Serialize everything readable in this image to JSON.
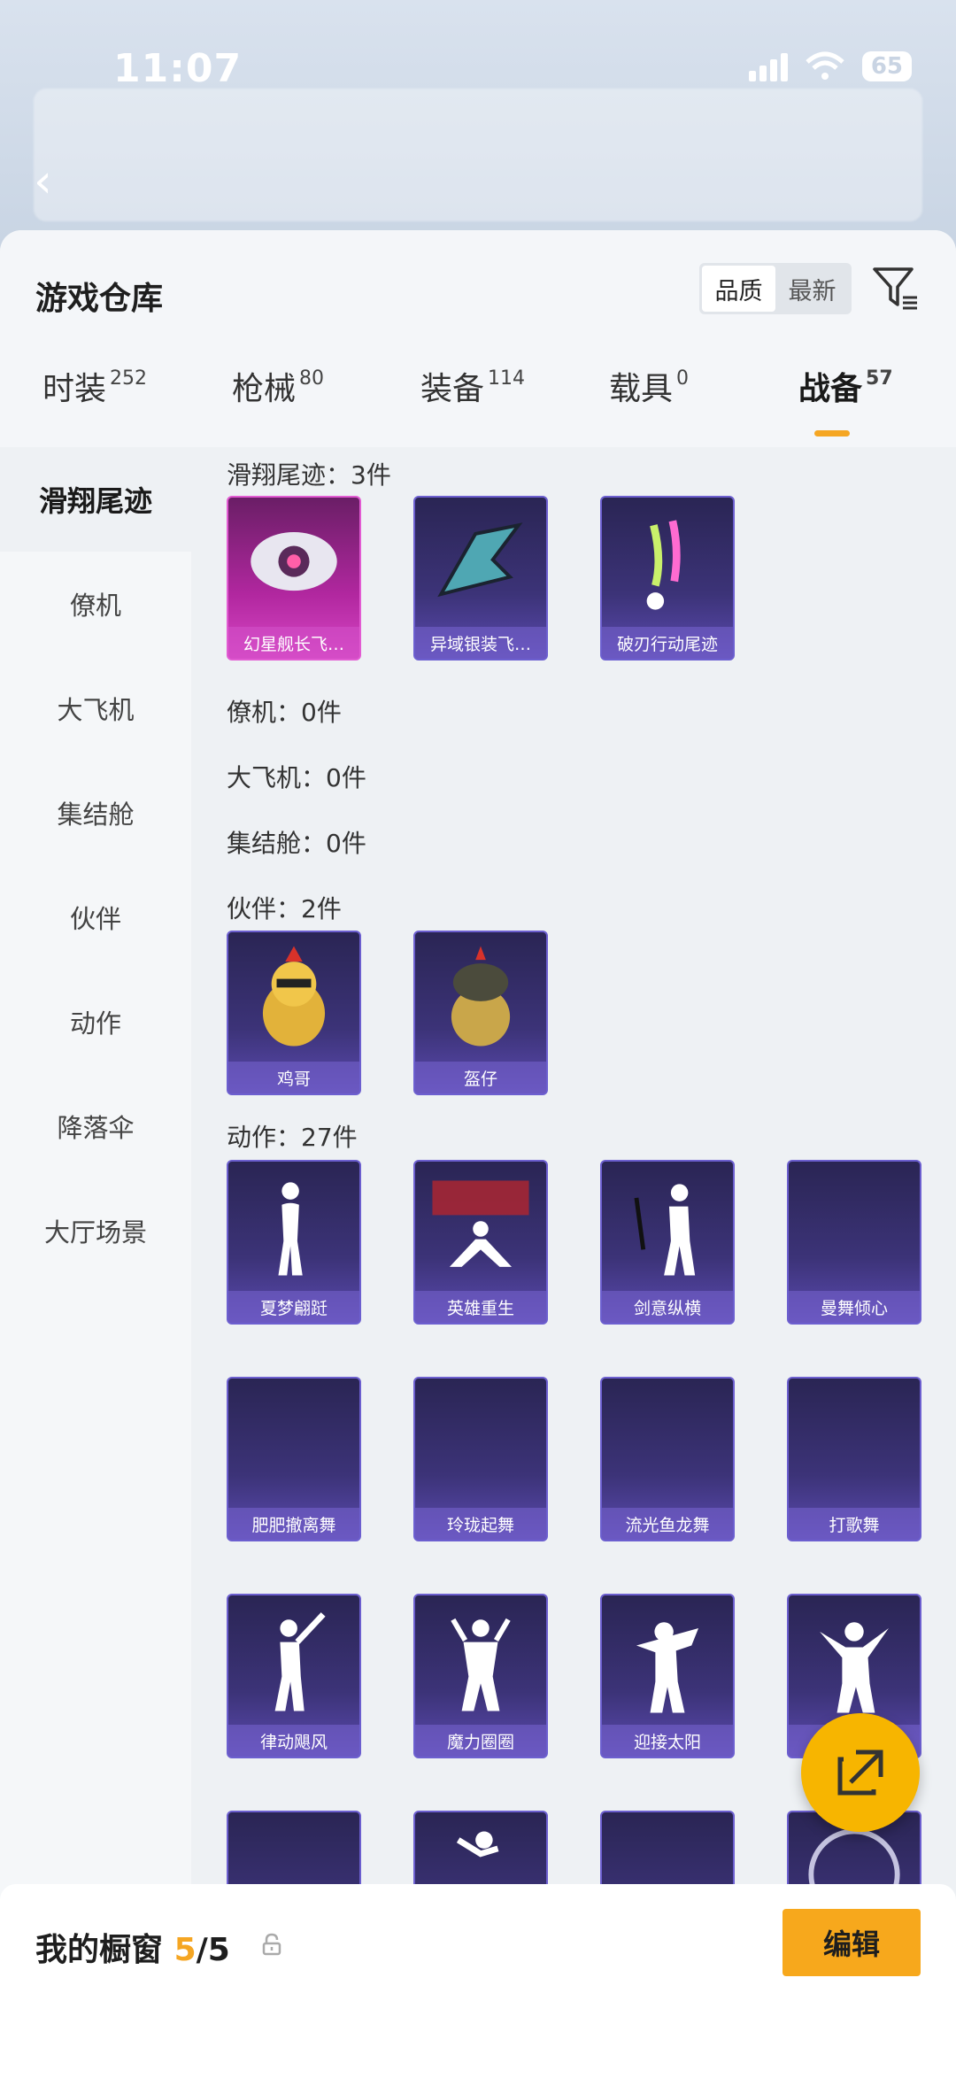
{
  "status_bar": {
    "time": "11:07",
    "battery": "65"
  },
  "header": {
    "title": "游戏仓库",
    "sort": [
      "品质",
      "最新"
    ]
  },
  "tabs": [
    {
      "label": "时装",
      "count": "252"
    },
    {
      "label": "枪械",
      "count": "80"
    },
    {
      "label": "装备",
      "count": "114"
    },
    {
      "label": "载具",
      "count": "0"
    },
    {
      "label": "战备",
      "count": "57"
    }
  ],
  "sidebar": [
    "滑翔尾迹",
    "僚机",
    "大飞机",
    "集结舱",
    "伙伴",
    "动作",
    "降落伞",
    "大厅场景"
  ],
  "sections": {
    "trail": {
      "title": "滑翔尾迹：3件",
      "items": [
        "幻星舰长飞…",
        "异域银装飞…",
        "破刃行动尾迹"
      ]
    },
    "wingman": {
      "title": "僚机：0件"
    },
    "plane": {
      "title": "大飞机：0件"
    },
    "pod": {
      "title": "集结舱：0件"
    },
    "partner": {
      "title": "伙伴：2件",
      "items": [
        "鸡哥",
        "盔仔"
      ]
    },
    "emote": {
      "title": "动作：27件",
      "items": [
        "夏梦翩跹",
        "英雄重生",
        "剑意纵横",
        "曼舞倾心",
        "肥肥撤离舞",
        "玲珑起舞",
        "流光鱼龙舞",
        "打歌舞",
        "律动飓风",
        "魔力圈圈",
        "迎接太阳",
        ""
      ]
    }
  },
  "bottom": {
    "label": "我的橱窗",
    "current": "5",
    "total": "/5",
    "edit": "编辑"
  },
  "colors": {
    "accent": "#f5a623",
    "card": "#3c3378",
    "legendary": "#b1279f"
  }
}
